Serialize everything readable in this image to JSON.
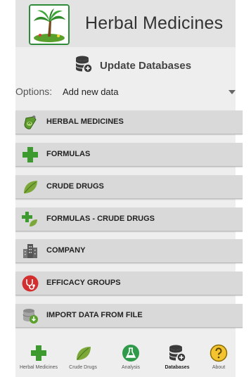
{
  "header": {
    "title": "Herbal Medicines"
  },
  "update": {
    "label": "Update Databases"
  },
  "options": {
    "prefix": "Options:",
    "value": "Add new data"
  },
  "menu": [
    {
      "label": "HERBAL MEDICINES",
      "icon": "herbal-bottle-icon"
    },
    {
      "label": "FORMULAS",
      "icon": "green-cross-icon"
    },
    {
      "label": "CRUDE DRUGS",
      "icon": "leaf-icon"
    },
    {
      "label": "FORMULAS - CRUDE DRUGS",
      "icon": "cross-leaf-icon"
    },
    {
      "label": "COMPANY",
      "icon": "building-icon"
    },
    {
      "label": "EFFICACY GROUPS",
      "icon": "stethoscope-icon"
    },
    {
      "label": "IMPORT DATA FROM FILE",
      "icon": "database-import-icon"
    }
  ],
  "nav": [
    {
      "label": "Herbal Medicines",
      "icon": "green-cross-icon"
    },
    {
      "label": "Crude Drugs",
      "icon": "leaf-icon"
    },
    {
      "label": "Analysis",
      "icon": "flask-icon"
    },
    {
      "label": "Databases",
      "icon": "database-icon",
      "active": true
    },
    {
      "label": "About",
      "icon": "question-icon"
    }
  ],
  "colors": {
    "accent_green": "#2e8b3a",
    "leaf_green": "#6b9a34",
    "red": "#d32f2f",
    "yellow": "#f4c430"
  }
}
